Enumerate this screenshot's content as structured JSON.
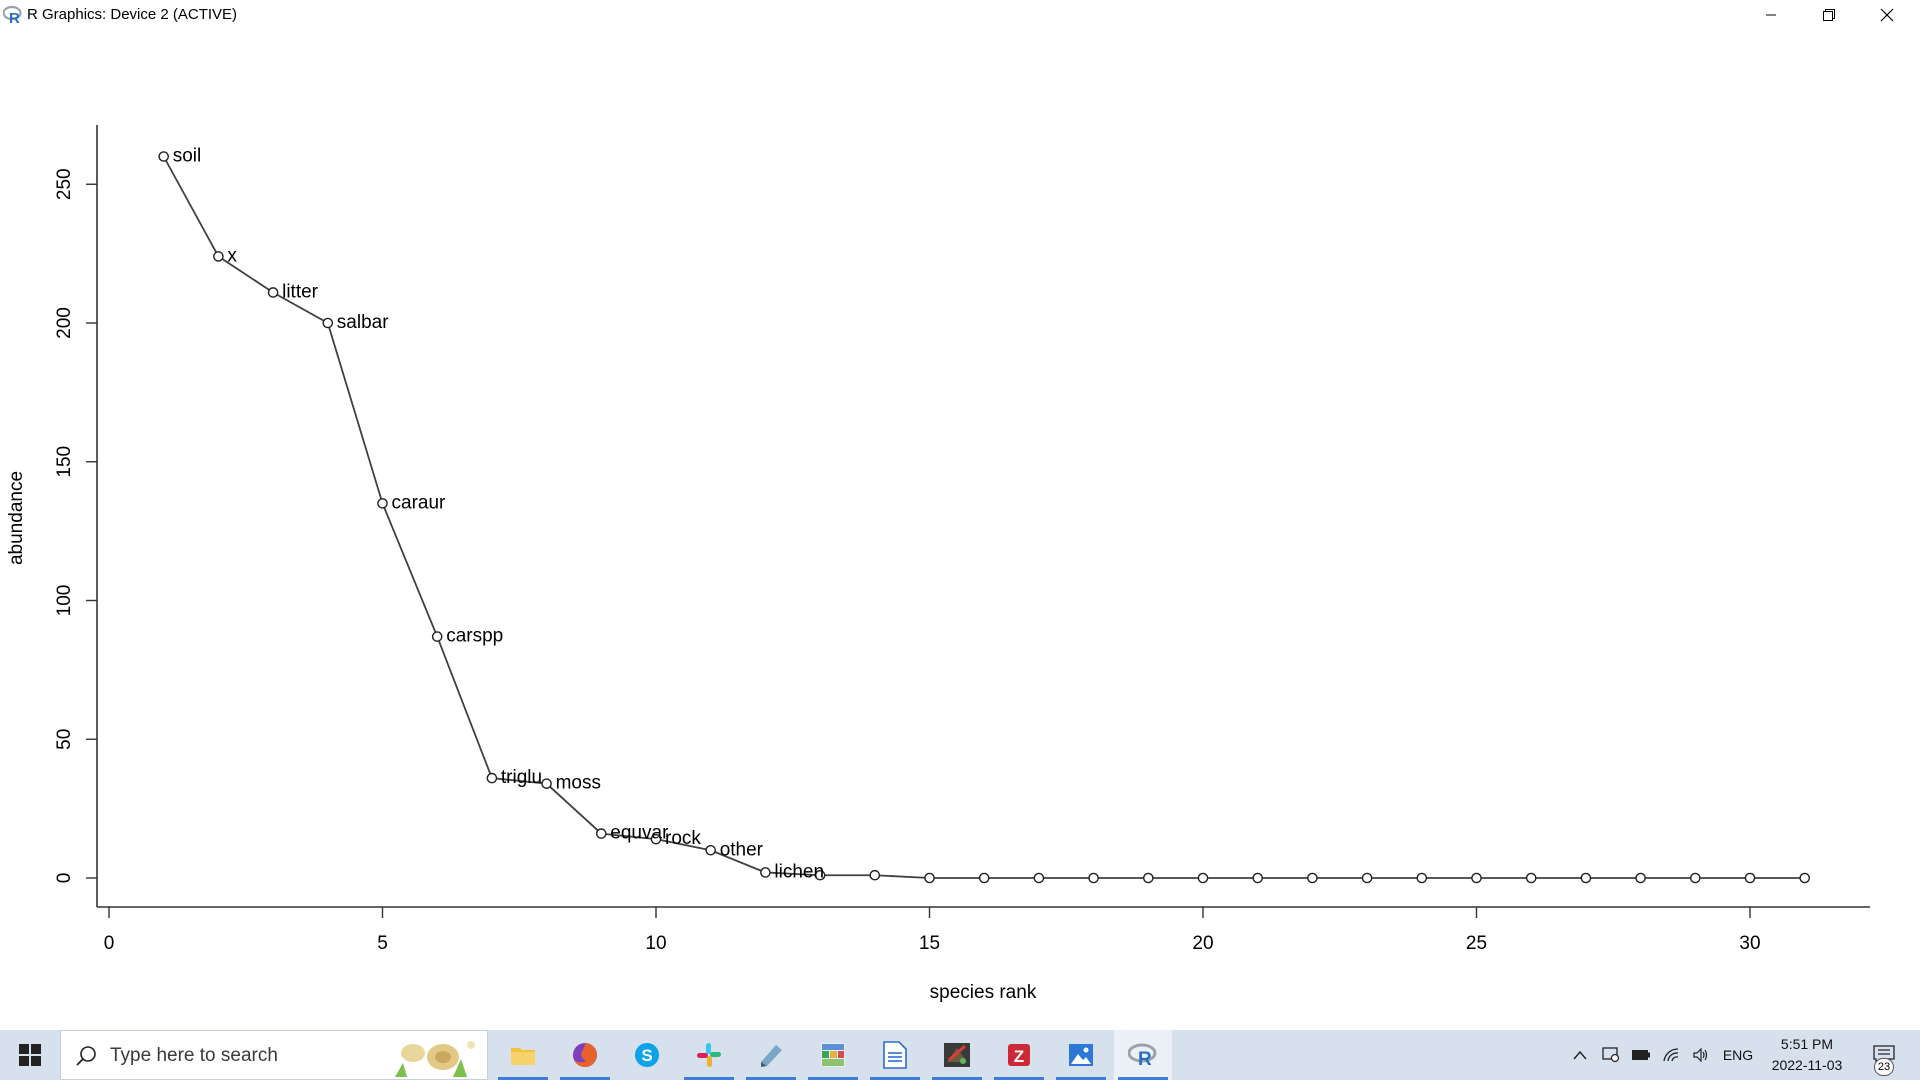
{
  "window": {
    "title": "R Graphics: Device 2 (ACTIVE)",
    "controls": {
      "minimize_icon": "minimize-icon",
      "maximize_icon": "restore-icon",
      "close_icon": "close-icon"
    }
  },
  "chart_data": {
    "type": "line",
    "title": "",
    "xlabel": "species rank",
    "ylabel": "abundance",
    "xlim": [
      0,
      32
    ],
    "ylim": [
      0,
      260
    ],
    "x_ticks": [
      0,
      5,
      10,
      15,
      20,
      25,
      30
    ],
    "y_ticks": [
      0,
      50,
      100,
      150,
      200,
      250
    ],
    "grid": false,
    "marker": "open-circle",
    "line_color": "#404040",
    "x": [
      1,
      2,
      3,
      4,
      5,
      6,
      7,
      8,
      9,
      10,
      11,
      12,
      13,
      14,
      15,
      16,
      17,
      18,
      19,
      20,
      21,
      22,
      23,
      24,
      25,
      26,
      27,
      28,
      29,
      30,
      31
    ],
    "y": [
      260,
      224,
      211,
      200,
      135,
      87,
      36,
      34,
      16,
      14,
      10,
      2,
      1,
      1,
      0,
      0,
      0,
      0,
      0,
      0,
      0,
      0,
      0,
      0,
      0,
      0,
      0,
      0,
      0,
      0,
      0
    ],
    "point_labels": [
      "soil",
      "x",
      "litter",
      "salbar",
      "caraur",
      "carspp",
      "triglu",
      "moss",
      "equvar",
      "rock",
      "other",
      "lichen"
    ]
  },
  "taskbar": {
    "search_placeholder": "Type here to search",
    "apps": [
      {
        "name": "file-explorer-icon",
        "color": "#f3c13a"
      },
      {
        "name": "firefox-icon",
        "color": "#e8632b"
      },
      {
        "name": "skype-icon",
        "color": "#0aa2e8"
      },
      {
        "name": "slack-icon",
        "color": "#36c5f0"
      },
      {
        "name": "notes-app-icon",
        "color": "#7aa6c8"
      },
      {
        "name": "spreadsheet-app-icon",
        "color": "#3aa655"
      },
      {
        "name": "writer-document-icon",
        "color": "#2b6cd1"
      },
      {
        "name": "gimp-icon",
        "color": "#6b5b45"
      },
      {
        "name": "zotero-icon",
        "color": "#cc2936"
      },
      {
        "name": "photos-icon",
        "color": "#2b78d8"
      },
      {
        "name": "r-app-icon",
        "color": "#276dc3"
      }
    ],
    "tray": {
      "language": "ENG",
      "time": "5:51 PM",
      "date": "2022-11-03",
      "notifications_count": "23"
    }
  }
}
